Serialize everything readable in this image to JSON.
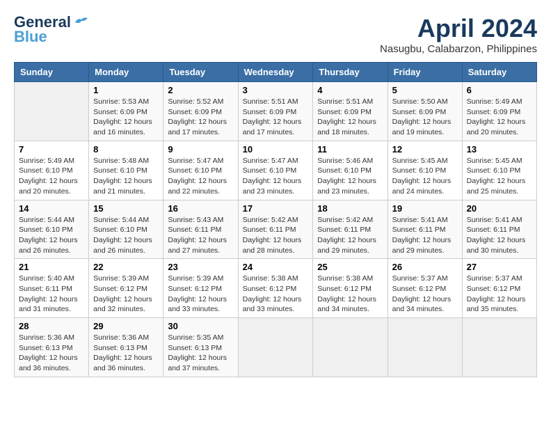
{
  "header": {
    "logo_line1": "General",
    "logo_line2": "Blue",
    "month_year": "April 2024",
    "location": "Nasugbu, Calabarzon, Philippines"
  },
  "columns": [
    "Sunday",
    "Monday",
    "Tuesday",
    "Wednesday",
    "Thursday",
    "Friday",
    "Saturday"
  ],
  "weeks": [
    [
      {
        "day": "",
        "empty": true
      },
      {
        "day": "1",
        "sunrise": "5:53 AM",
        "sunset": "6:09 PM",
        "daylight": "12 hours and 16 minutes."
      },
      {
        "day": "2",
        "sunrise": "5:52 AM",
        "sunset": "6:09 PM",
        "daylight": "12 hours and 17 minutes."
      },
      {
        "day": "3",
        "sunrise": "5:51 AM",
        "sunset": "6:09 PM",
        "daylight": "12 hours and 17 minutes."
      },
      {
        "day": "4",
        "sunrise": "5:51 AM",
        "sunset": "6:09 PM",
        "daylight": "12 hours and 18 minutes."
      },
      {
        "day": "5",
        "sunrise": "5:50 AM",
        "sunset": "6:09 PM",
        "daylight": "12 hours and 19 minutes."
      },
      {
        "day": "6",
        "sunrise": "5:49 AM",
        "sunset": "6:09 PM",
        "daylight": "12 hours and 20 minutes."
      }
    ],
    [
      {
        "day": "7",
        "sunrise": "5:49 AM",
        "sunset": "6:10 PM",
        "daylight": "12 hours and 20 minutes."
      },
      {
        "day": "8",
        "sunrise": "5:48 AM",
        "sunset": "6:10 PM",
        "daylight": "12 hours and 21 minutes."
      },
      {
        "day": "9",
        "sunrise": "5:47 AM",
        "sunset": "6:10 PM",
        "daylight": "12 hours and 22 minutes."
      },
      {
        "day": "10",
        "sunrise": "5:47 AM",
        "sunset": "6:10 PM",
        "daylight": "12 hours and 23 minutes."
      },
      {
        "day": "11",
        "sunrise": "5:46 AM",
        "sunset": "6:10 PM",
        "daylight": "12 hours and 23 minutes."
      },
      {
        "day": "12",
        "sunrise": "5:45 AM",
        "sunset": "6:10 PM",
        "daylight": "12 hours and 24 minutes."
      },
      {
        "day": "13",
        "sunrise": "5:45 AM",
        "sunset": "6:10 PM",
        "daylight": "12 hours and 25 minutes."
      }
    ],
    [
      {
        "day": "14",
        "sunrise": "5:44 AM",
        "sunset": "6:10 PM",
        "daylight": "12 hours and 26 minutes."
      },
      {
        "day": "15",
        "sunrise": "5:44 AM",
        "sunset": "6:10 PM",
        "daylight": "12 hours and 26 minutes."
      },
      {
        "day": "16",
        "sunrise": "5:43 AM",
        "sunset": "6:11 PM",
        "daylight": "12 hours and 27 minutes."
      },
      {
        "day": "17",
        "sunrise": "5:42 AM",
        "sunset": "6:11 PM",
        "daylight": "12 hours and 28 minutes."
      },
      {
        "day": "18",
        "sunrise": "5:42 AM",
        "sunset": "6:11 PM",
        "daylight": "12 hours and 29 minutes."
      },
      {
        "day": "19",
        "sunrise": "5:41 AM",
        "sunset": "6:11 PM",
        "daylight": "12 hours and 29 minutes."
      },
      {
        "day": "20",
        "sunrise": "5:41 AM",
        "sunset": "6:11 PM",
        "daylight": "12 hours and 30 minutes."
      }
    ],
    [
      {
        "day": "21",
        "sunrise": "5:40 AM",
        "sunset": "6:11 PM",
        "daylight": "12 hours and 31 minutes."
      },
      {
        "day": "22",
        "sunrise": "5:39 AM",
        "sunset": "6:12 PM",
        "daylight": "12 hours and 32 minutes."
      },
      {
        "day": "23",
        "sunrise": "5:39 AM",
        "sunset": "6:12 PM",
        "daylight": "12 hours and 33 minutes."
      },
      {
        "day": "24",
        "sunrise": "5:38 AM",
        "sunset": "6:12 PM",
        "daylight": "12 hours and 33 minutes."
      },
      {
        "day": "25",
        "sunrise": "5:38 AM",
        "sunset": "6:12 PM",
        "daylight": "12 hours and 34 minutes."
      },
      {
        "day": "26",
        "sunrise": "5:37 AM",
        "sunset": "6:12 PM",
        "daylight": "12 hours and 34 minutes."
      },
      {
        "day": "27",
        "sunrise": "5:37 AM",
        "sunset": "6:12 PM",
        "daylight": "12 hours and 35 minutes."
      }
    ],
    [
      {
        "day": "28",
        "sunrise": "5:36 AM",
        "sunset": "6:13 PM",
        "daylight": "12 hours and 36 minutes."
      },
      {
        "day": "29",
        "sunrise": "5:36 AM",
        "sunset": "6:13 PM",
        "daylight": "12 hours and 36 minutes."
      },
      {
        "day": "30",
        "sunrise": "5:35 AM",
        "sunset": "6:13 PM",
        "daylight": "12 hours and 37 minutes."
      },
      {
        "day": "",
        "empty": true
      },
      {
        "day": "",
        "empty": true
      },
      {
        "day": "",
        "empty": true
      },
      {
        "day": "",
        "empty": true
      }
    ]
  ]
}
